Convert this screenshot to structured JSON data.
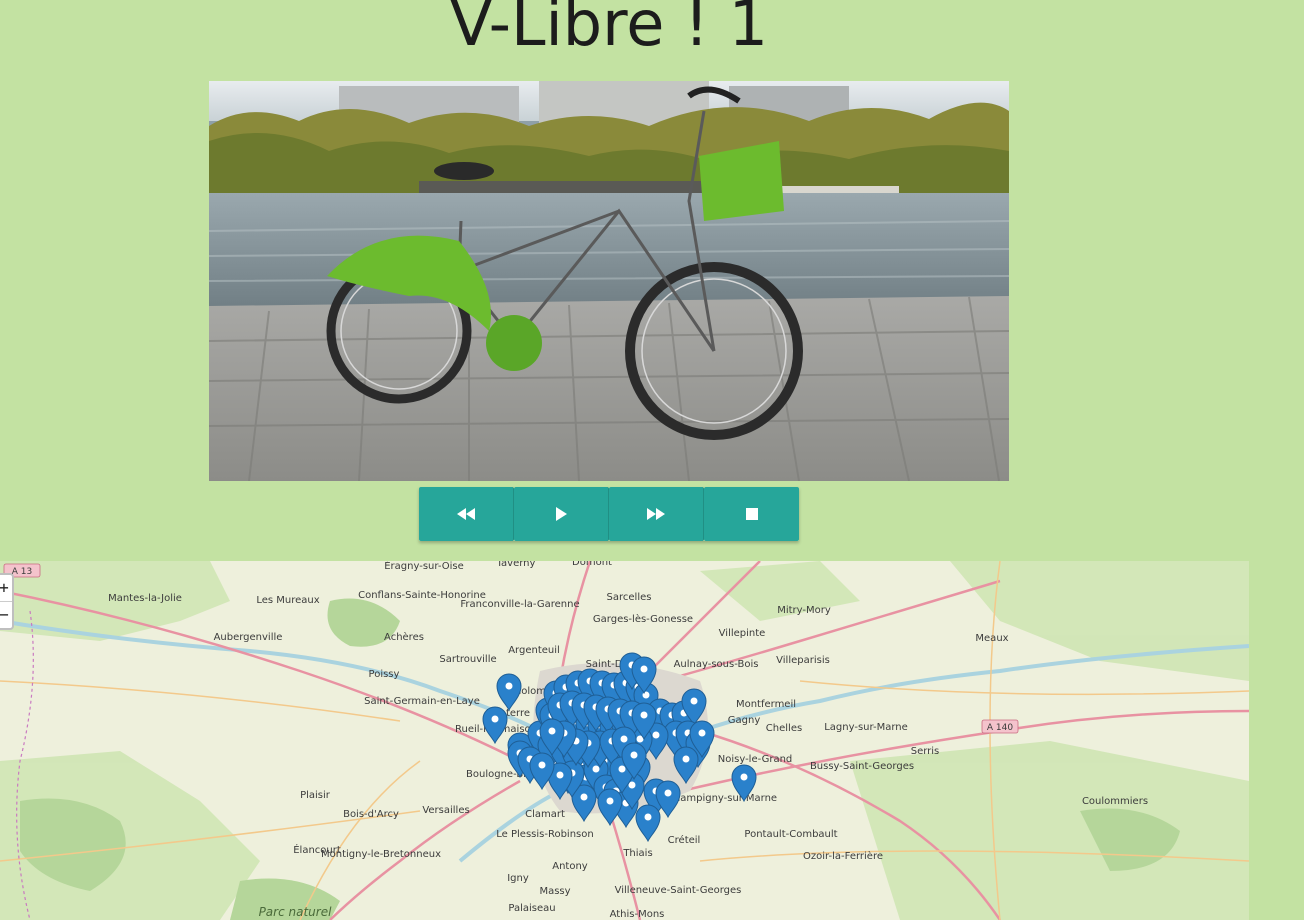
{
  "header": {
    "title": "V-Libre ! 1"
  },
  "controls": [
    {
      "name": "rewind-button",
      "icon": "rewind-icon"
    },
    {
      "name": "play-button",
      "icon": "play-icon"
    },
    {
      "name": "fast-forward-button",
      "icon": "fast-forward-icon"
    },
    {
      "name": "stop-button",
      "icon": "stop-icon"
    }
  ],
  "map": {
    "zoom_in": "+",
    "zoom_out": "−",
    "road_labels": [
      "A 13",
      "A 140"
    ],
    "places": [
      "Mantes-la-Jolie",
      "Les Mureaux",
      "Aubergenville",
      "Éragny-sur-Oise",
      "Conflans-Sainte-Honorine",
      "Taverny",
      "Domont",
      "Sarcelles",
      "Franconville-la-Garenne",
      "Garges-lès-Gonesse",
      "Villepinte",
      "Mitry-Mory",
      "Meaux",
      "Achères",
      "Sartrouville",
      "Argenteuil",
      "Saint-D",
      "Aulnay-sous-Bois",
      "Villeparisis",
      "Poissy",
      "Colombes",
      "Montfermeil",
      "Saint-Germain-en-Laye",
      "Nanterre",
      "Gagny",
      "Chelles",
      "Lagny-sur-Marne",
      "Rueil-Malmaison",
      "Serris",
      "Noisy-le-Grand",
      "Bussy-Saint-Georges",
      "Boulogne-Bi",
      "Champigny-sur-Marne",
      "Coulommiers",
      "Plaisir",
      "Versailles",
      "Bois-d'Arcy",
      "Clamart",
      "Le Plessis-Robinson",
      "Pontault-Combault",
      "Élancourt",
      "Montigny-le-Bretonneux",
      "Créteil",
      "Thiais",
      "Ozoir-la-Ferrière",
      "Antony",
      "Igny",
      "Massy",
      "Villeneuve-Saint-Georges",
      "Palaiseau",
      "Athis-Mons",
      "Parc naturel"
    ],
    "colors": {
      "marker": "#2a81cb",
      "motorway": "#e892a2",
      "water": "#aad3df"
    }
  }
}
